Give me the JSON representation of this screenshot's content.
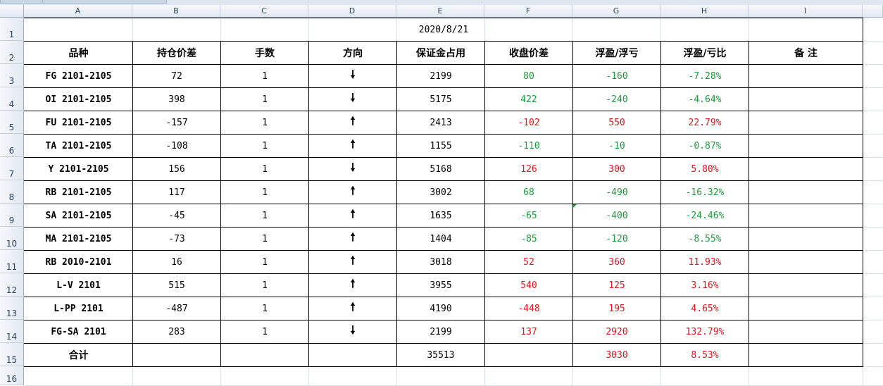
{
  "columns": [
    "A",
    "B",
    "C",
    "D",
    "E",
    "F",
    "G",
    "H",
    "I"
  ],
  "row_numbers": [
    "1",
    "2",
    "3",
    "4",
    "5",
    "6",
    "7",
    "8",
    "9",
    "10",
    "11",
    "12",
    "13",
    "14",
    "15",
    "16"
  ],
  "title": "2020/8/21",
  "headers": [
    "品种",
    "持仓价差",
    "手数",
    "方向",
    "保证金占用",
    "收盘价差",
    "浮盈/浮亏",
    "浮盈/亏比",
    "备 注"
  ],
  "rows": [
    {
      "variety": "FG 2101-2105",
      "spread": "72",
      "lots": "1",
      "dir": "down",
      "margin": "2199",
      "close": "80",
      "close_c": "green",
      "pnl": "-160",
      "pnl_c": "green",
      "ratio": "-7.28%",
      "ratio_c": "green",
      "note": ""
    },
    {
      "variety": "OI 2101-2105",
      "spread": "398",
      "lots": "1",
      "dir": "down",
      "margin": "5175",
      "close": "422",
      "close_c": "green",
      "pnl": "-240",
      "pnl_c": "green",
      "ratio": "-4.64%",
      "ratio_c": "green",
      "note": ""
    },
    {
      "variety": "FU 2101-2105",
      "spread": "-157",
      "lots": "1",
      "dir": "up",
      "margin": "2413",
      "close": "-102",
      "close_c": "red",
      "pnl": "550",
      "pnl_c": "red",
      "ratio": "22.79%",
      "ratio_c": "red",
      "note": ""
    },
    {
      "variety": "TA 2101-2105",
      "spread": "-108",
      "lots": "1",
      "dir": "up",
      "margin": "1155",
      "close": "-110",
      "close_c": "green",
      "pnl": "-10",
      "pnl_c": "green",
      "ratio": "-0.87%",
      "ratio_c": "green",
      "note": ""
    },
    {
      "variety": "Y 2101-2105",
      "spread": "156",
      "lots": "1",
      "dir": "down",
      "margin": "5168",
      "close": "126",
      "close_c": "red",
      "pnl": "300",
      "pnl_c": "red",
      "ratio": "5.80%",
      "ratio_c": "red",
      "note": ""
    },
    {
      "variety": "RB 2101-2105",
      "spread": "117",
      "lots": "1",
      "dir": "up",
      "margin": "3002",
      "close": "68",
      "close_c": "green",
      "pnl": "-490",
      "pnl_c": "green",
      "ratio": "-16.32%",
      "ratio_c": "green",
      "note": ""
    },
    {
      "variety": "SA 2101-2105",
      "spread": "-45",
      "lots": "1",
      "dir": "up",
      "margin": "1635",
      "close": "-65",
      "close_c": "green",
      "pnl": "-400",
      "pnl_c": "green",
      "ratio": "-24.46%",
      "ratio_c": "green",
      "note": ""
    },
    {
      "variety": "MA 2101-2105",
      "spread": "-73",
      "lots": "1",
      "dir": "up",
      "margin": "1404",
      "close": "-85",
      "close_c": "green",
      "pnl": "-120",
      "pnl_c": "green",
      "ratio": "-8.55%",
      "ratio_c": "green",
      "note": ""
    },
    {
      "variety": "RB 2010-2101",
      "spread": "16",
      "lots": "1",
      "dir": "up",
      "margin": "3018",
      "close": "52",
      "close_c": "red",
      "pnl": "360",
      "pnl_c": "red",
      "ratio": "11.93%",
      "ratio_c": "red",
      "note": ""
    },
    {
      "variety": "L-V 2101",
      "spread": "515",
      "lots": "1",
      "dir": "up",
      "margin": "3955",
      "close": "540",
      "close_c": "red",
      "pnl": "125",
      "pnl_c": "red",
      "ratio": "3.16%",
      "ratio_c": "red",
      "note": ""
    },
    {
      "variety": "L-PP 2101",
      "spread": "-487",
      "lots": "1",
      "dir": "up",
      "margin": "4190",
      "close": "-448",
      "close_c": "red",
      "pnl": "195",
      "pnl_c": "red",
      "ratio": "4.65%",
      "ratio_c": "red",
      "note": ""
    },
    {
      "variety": "FG-SA 2101",
      "spread": "283",
      "lots": "1",
      "dir": "down",
      "margin": "2199",
      "close": "137",
      "close_c": "red",
      "pnl": "2920",
      "pnl_c": "red",
      "ratio": "132.79%",
      "ratio_c": "red",
      "note": ""
    }
  ],
  "total": {
    "label": "合计",
    "margin": "35513",
    "pnl": "3030",
    "pnl_c": "red",
    "ratio": "8.53%",
    "ratio_c": "red"
  },
  "arrows": {
    "up": "🠕",
    "down": "🠗"
  },
  "colors": {
    "green": "#1a9a3a",
    "red": "#e0151b",
    "grid": "#dadfe6",
    "header_bg": "#e3e9f2"
  }
}
